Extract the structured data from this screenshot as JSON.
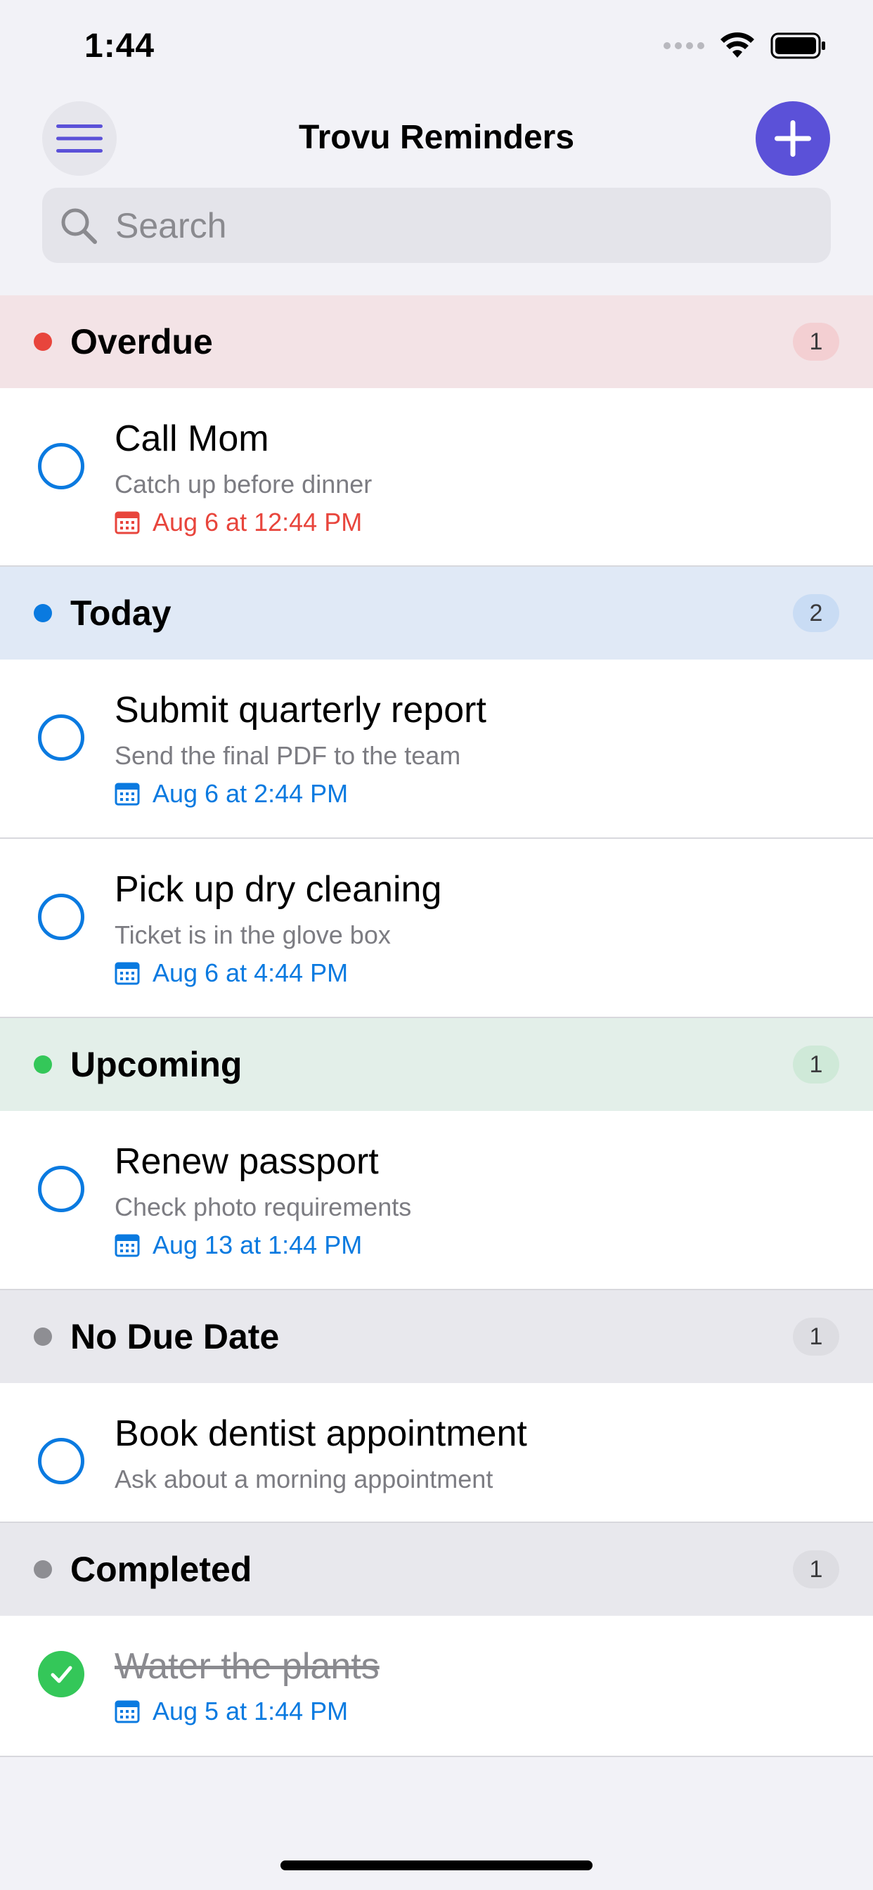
{
  "status_bar": {
    "time": "1:44"
  },
  "header": {
    "title": "Trovu Reminders"
  },
  "search": {
    "placeholder": "Search"
  },
  "colors": {
    "accent": "#5B51D8",
    "blue": "#0A7AE0",
    "red": "#E8453C",
    "green": "#34C759",
    "gray": "#8E8E93"
  },
  "sections": [
    {
      "title": "Overdue",
      "count": "1",
      "items": [
        {
          "title": "Call Mom",
          "note": "Catch up before dinner",
          "date": "Aug 6 at 12:44 PM",
          "completed": false
        }
      ]
    },
    {
      "title": "Today",
      "count": "2",
      "items": [
        {
          "title": "Submit quarterly report",
          "note": "Send the final PDF to the team",
          "date": "Aug 6 at 2:44 PM",
          "completed": false
        },
        {
          "title": "Pick up dry cleaning",
          "note": "Ticket is in the glove box",
          "date": "Aug 6 at 4:44 PM",
          "completed": false
        }
      ]
    },
    {
      "title": "Upcoming",
      "count": "1",
      "items": [
        {
          "title": "Renew passport",
          "note": "Check photo requirements",
          "date": "Aug 13 at 1:44 PM",
          "completed": false
        }
      ]
    },
    {
      "title": "No Due Date",
      "count": "1",
      "items": [
        {
          "title": "Book dentist appointment",
          "note": "Ask about a morning appointment",
          "completed": false
        }
      ]
    },
    {
      "title": "Completed",
      "count": "1",
      "items": [
        {
          "title": "Water the plants",
          "date": "Aug 5 at 1:44 PM",
          "completed": true
        }
      ]
    }
  ]
}
